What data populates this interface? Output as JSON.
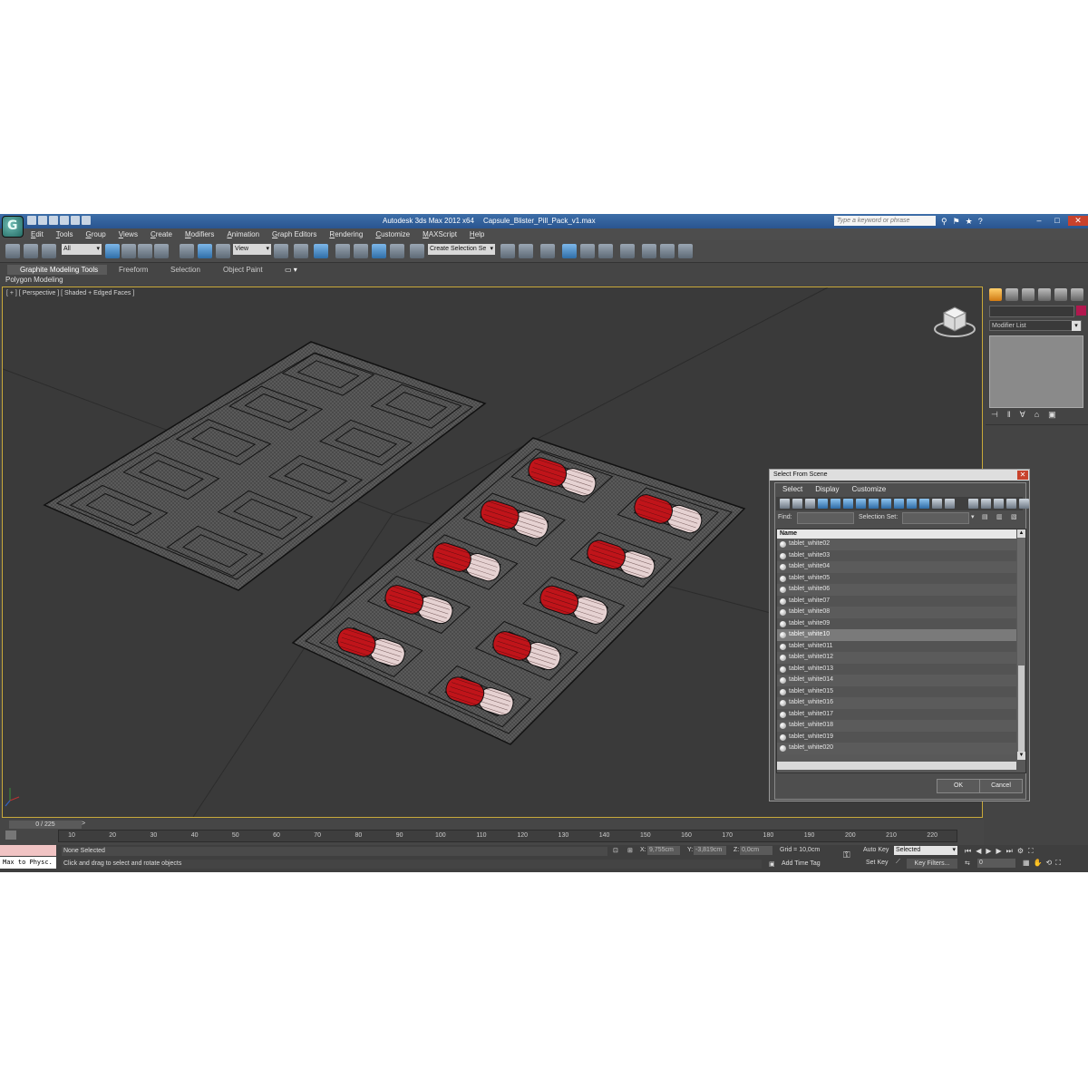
{
  "title_bar": {
    "app_title": "Autodesk 3ds Max  2012 x64",
    "file_name": "Capsule_Blister_Pill_Pack_v1.max",
    "search_placeholder": "Type a keyword or phrase"
  },
  "menu": [
    "Edit",
    "Tools",
    "Group",
    "Views",
    "Create",
    "Modifiers",
    "Animation",
    "Graph Editors",
    "Rendering",
    "Customize",
    "MAXScript",
    "Help"
  ],
  "toolbar": {
    "filter_value": "All",
    "coord_system": "View",
    "named_selection": "Create Selection Se"
  },
  "ribbon": {
    "tabs": [
      "Graphite Modeling Tools",
      "Freeform",
      "Selection",
      "Object Paint"
    ],
    "sub_label": "Polygon Modeling"
  },
  "viewport": {
    "label": "[ + ] [ Perspective ] [ Shaded + Edged Faces ]"
  },
  "command_panel": {
    "modifier_list": "Modifier List"
  },
  "timeline": {
    "slider": "0 / 225",
    "next": ">",
    "ticks": [
      "10",
      "20",
      "30",
      "40",
      "50",
      "60",
      "70",
      "80",
      "90",
      "100",
      "110",
      "120",
      "130",
      "140",
      "150",
      "160",
      "170",
      "180",
      "190",
      "200",
      "210",
      "220"
    ]
  },
  "status": {
    "maxscript": "Max to Physc.",
    "selection": "None Selected",
    "prompt": "Click and drag to select and rotate objects",
    "x_label": "X:",
    "x_value": "9,755cm",
    "y_label": "Y:",
    "y_value": "-3,819cm",
    "z_label": "Z:",
    "z_value": "0,0cm",
    "grid": "Grid = 10,0cm",
    "add_time_tag": "Add Time Tag",
    "auto_key": "Auto Key",
    "set_key": "Set Key",
    "selected_option": "Selected",
    "key_filters": "Key Filters...",
    "frame": "0"
  },
  "dialog": {
    "title": "Select From Scene",
    "menu": [
      "Select",
      "Display",
      "Customize"
    ],
    "find_label": "Find:",
    "selection_set_label": "Selection Set:",
    "column_name": "Name",
    "items": [
      "tablet_white02",
      "tablet_white03",
      "tablet_white04",
      "tablet_white05",
      "tablet_white06",
      "tablet_white07",
      "tablet_white08",
      "tablet_white09",
      "tablet_white10",
      "tablet_white011",
      "tablet_white012",
      "tablet_white013",
      "tablet_white014",
      "tablet_white015",
      "tablet_white016",
      "tablet_white017",
      "tablet_white018",
      "tablet_white019",
      "tablet_white020"
    ],
    "ok": "OK",
    "cancel": "Cancel"
  },
  "colors": {
    "capsule_red": "#c0141a",
    "capsule_white": "#e6d2d2",
    "viewport_border": "#c9a93a",
    "title_blue": "#2f5f9c"
  }
}
